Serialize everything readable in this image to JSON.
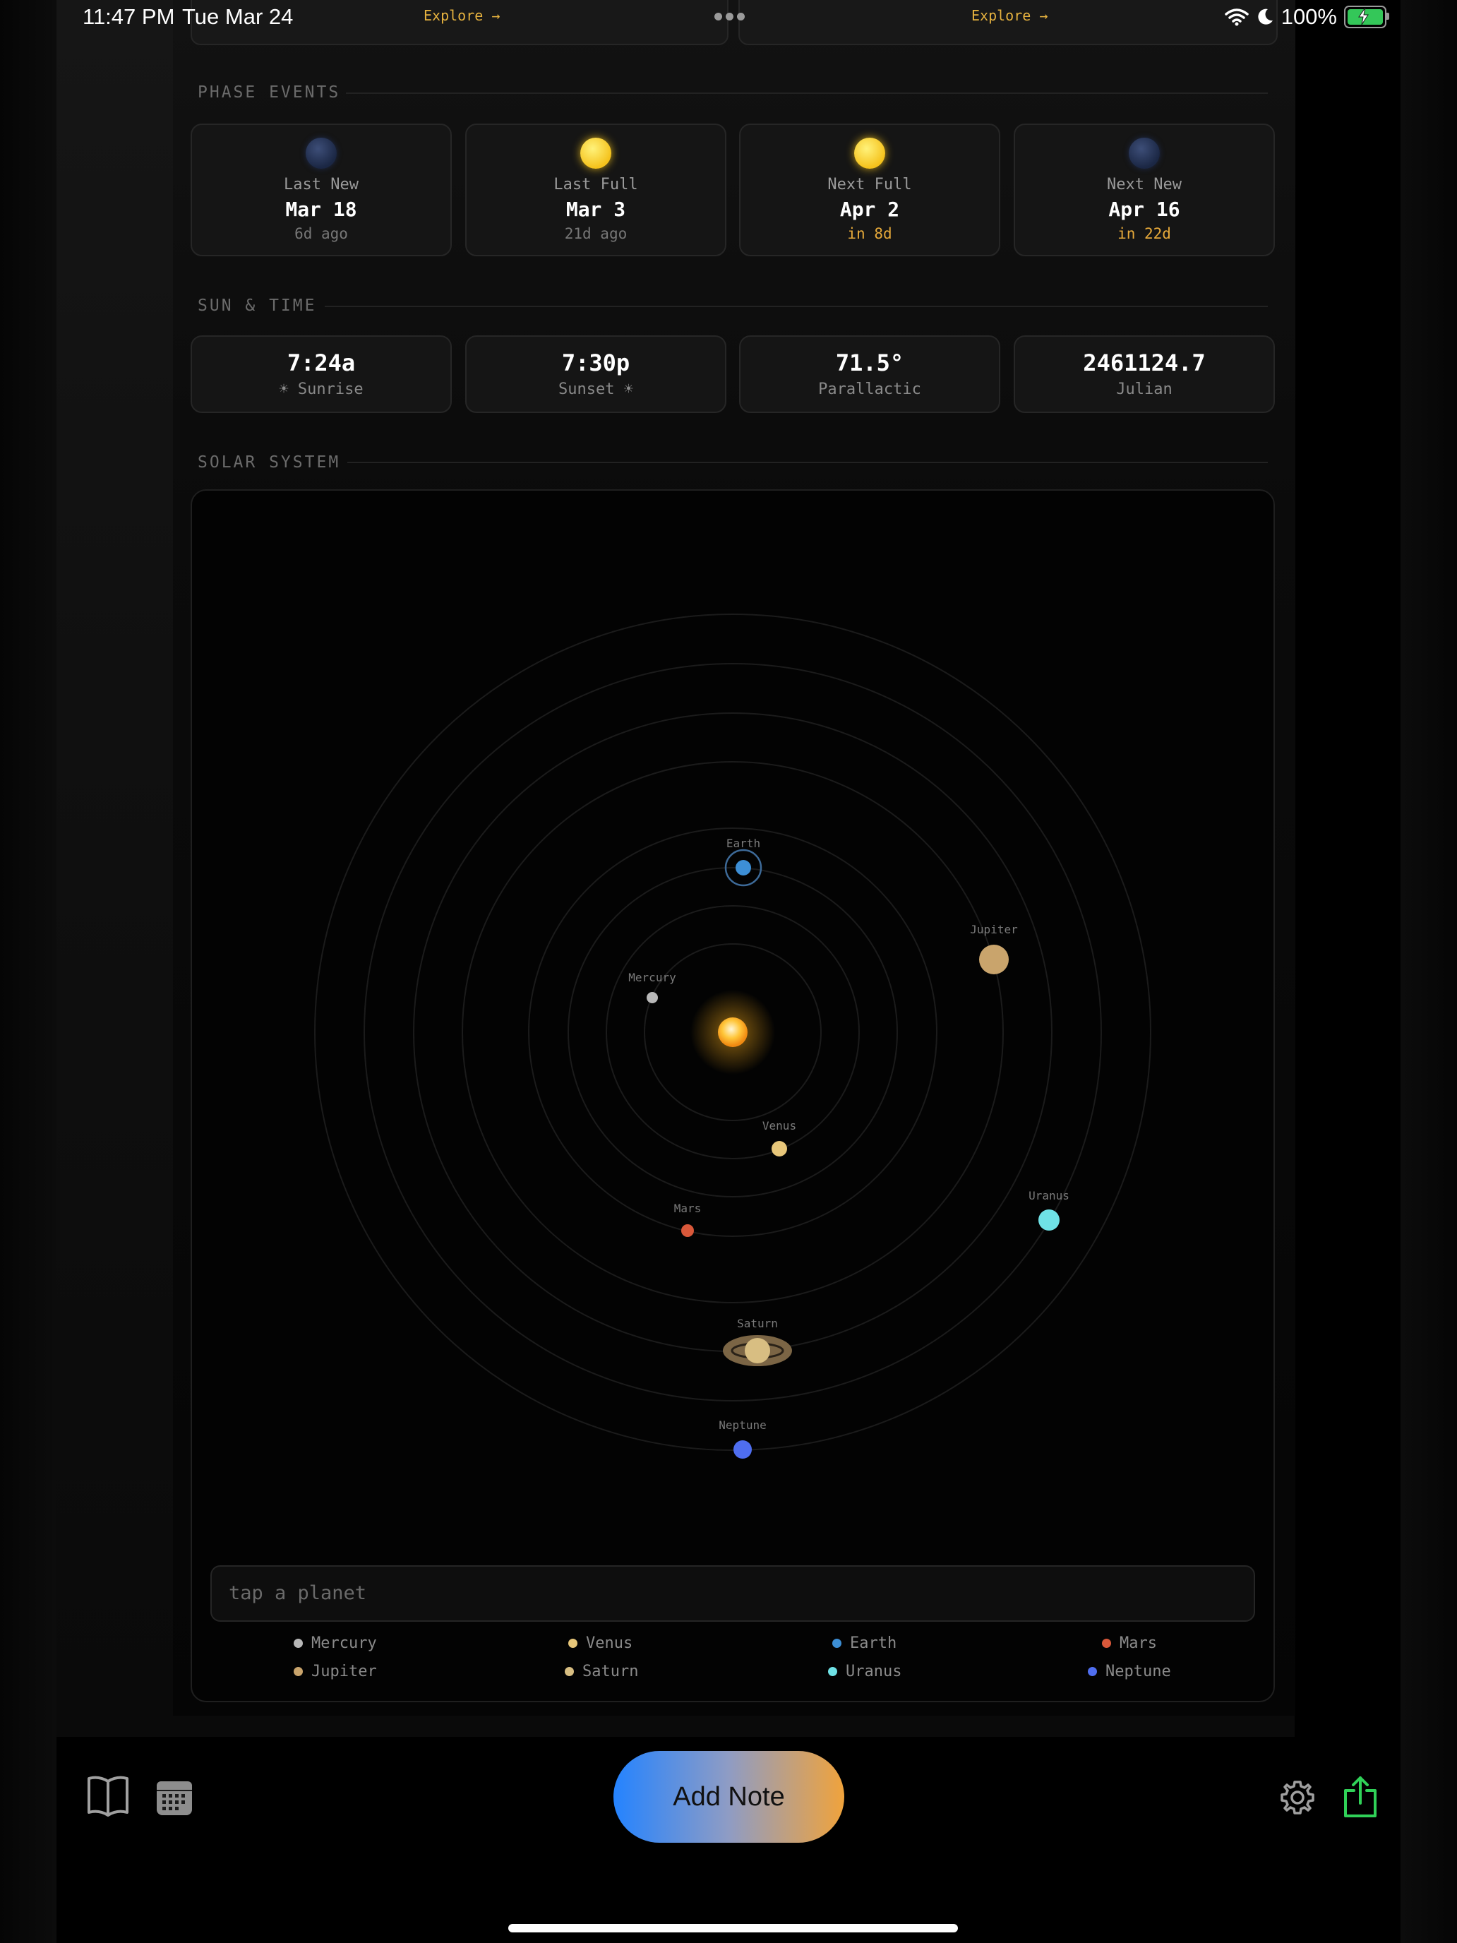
{
  "status_bar": {
    "time": "11:47 PM",
    "date": "Tue Mar 24",
    "battery": "100%"
  },
  "top_cards": {
    "explore_label": "Explore →"
  },
  "sections": {
    "phase_events": "PHASE EVENTS",
    "sun_time": "SUN & TIME",
    "solar_system": "SOLAR SYSTEM"
  },
  "phase_events": [
    {
      "label": "Last New",
      "date": "Mar 18",
      "relative": "6d ago",
      "phase": "new"
    },
    {
      "label": "Last Full",
      "date": "Mar 3",
      "relative": "21d ago",
      "phase": "full"
    },
    {
      "label": "Next Full",
      "date": "Apr 2",
      "relative": "in 8d",
      "phase": "full"
    },
    {
      "label": "Next New",
      "date": "Apr 16",
      "relative": "in 22d",
      "phase": "new"
    }
  ],
  "sun_time": [
    {
      "value": "7:24a",
      "label": "☀ Sunrise"
    },
    {
      "value": "7:30p",
      "label": "Sunset ☀"
    },
    {
      "value": "71.5°",
      "label": "Parallactic"
    },
    {
      "value": "2461124.7",
      "label": "Julian"
    }
  ],
  "planets": [
    {
      "name": "Mercury",
      "color": "#b8b8b8"
    },
    {
      "name": "Venus",
      "color": "#e8c77a"
    },
    {
      "name": "Earth",
      "color": "#3d8fd6"
    },
    {
      "name": "Mars",
      "color": "#d9583a"
    },
    {
      "name": "Jupiter",
      "color": "#c9a46c"
    },
    {
      "name": "Saturn",
      "color": "#d8be82"
    },
    {
      "name": "Uranus",
      "color": "#6fe2e6"
    },
    {
      "name": "Neptune",
      "color": "#4f6ef0"
    }
  ],
  "planet_info": {
    "placeholder": "tap a planet"
  },
  "toolbar": {
    "add_note_label": "Add Note"
  },
  "colors": {
    "accent": "#e6a93a",
    "sun": "#ffb21c"
  }
}
